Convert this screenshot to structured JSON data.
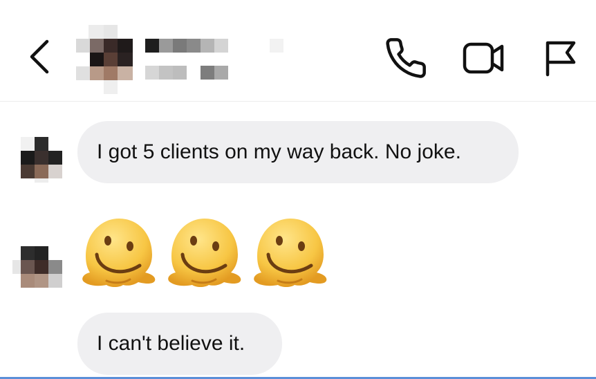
{
  "header": {
    "back_icon": "chevron-left-icon",
    "contact_name": "",
    "contact_status": "",
    "actions": [
      {
        "name": "voice-call",
        "icon": "phone-icon"
      },
      {
        "name": "video-call",
        "icon": "video-camera-icon"
      },
      {
        "name": "report",
        "icon": "flag-icon"
      }
    ]
  },
  "messages": [
    {
      "sender": "contact",
      "type": "text",
      "text": "I got 5 clients on my way back. No joke."
    },
    {
      "sender": "contact",
      "type": "emoji",
      "emoji": [
        "melting-face-emoji",
        "melting-face-emoji",
        "melting-face-emoji"
      ]
    },
    {
      "sender": "contact",
      "type": "text",
      "text": "I can't believe it."
    }
  ],
  "colors": {
    "bubble_bg": "#efeff1",
    "icon": "#111111",
    "divider": "#ececec",
    "bottom_accent": "#5b8fd8"
  }
}
